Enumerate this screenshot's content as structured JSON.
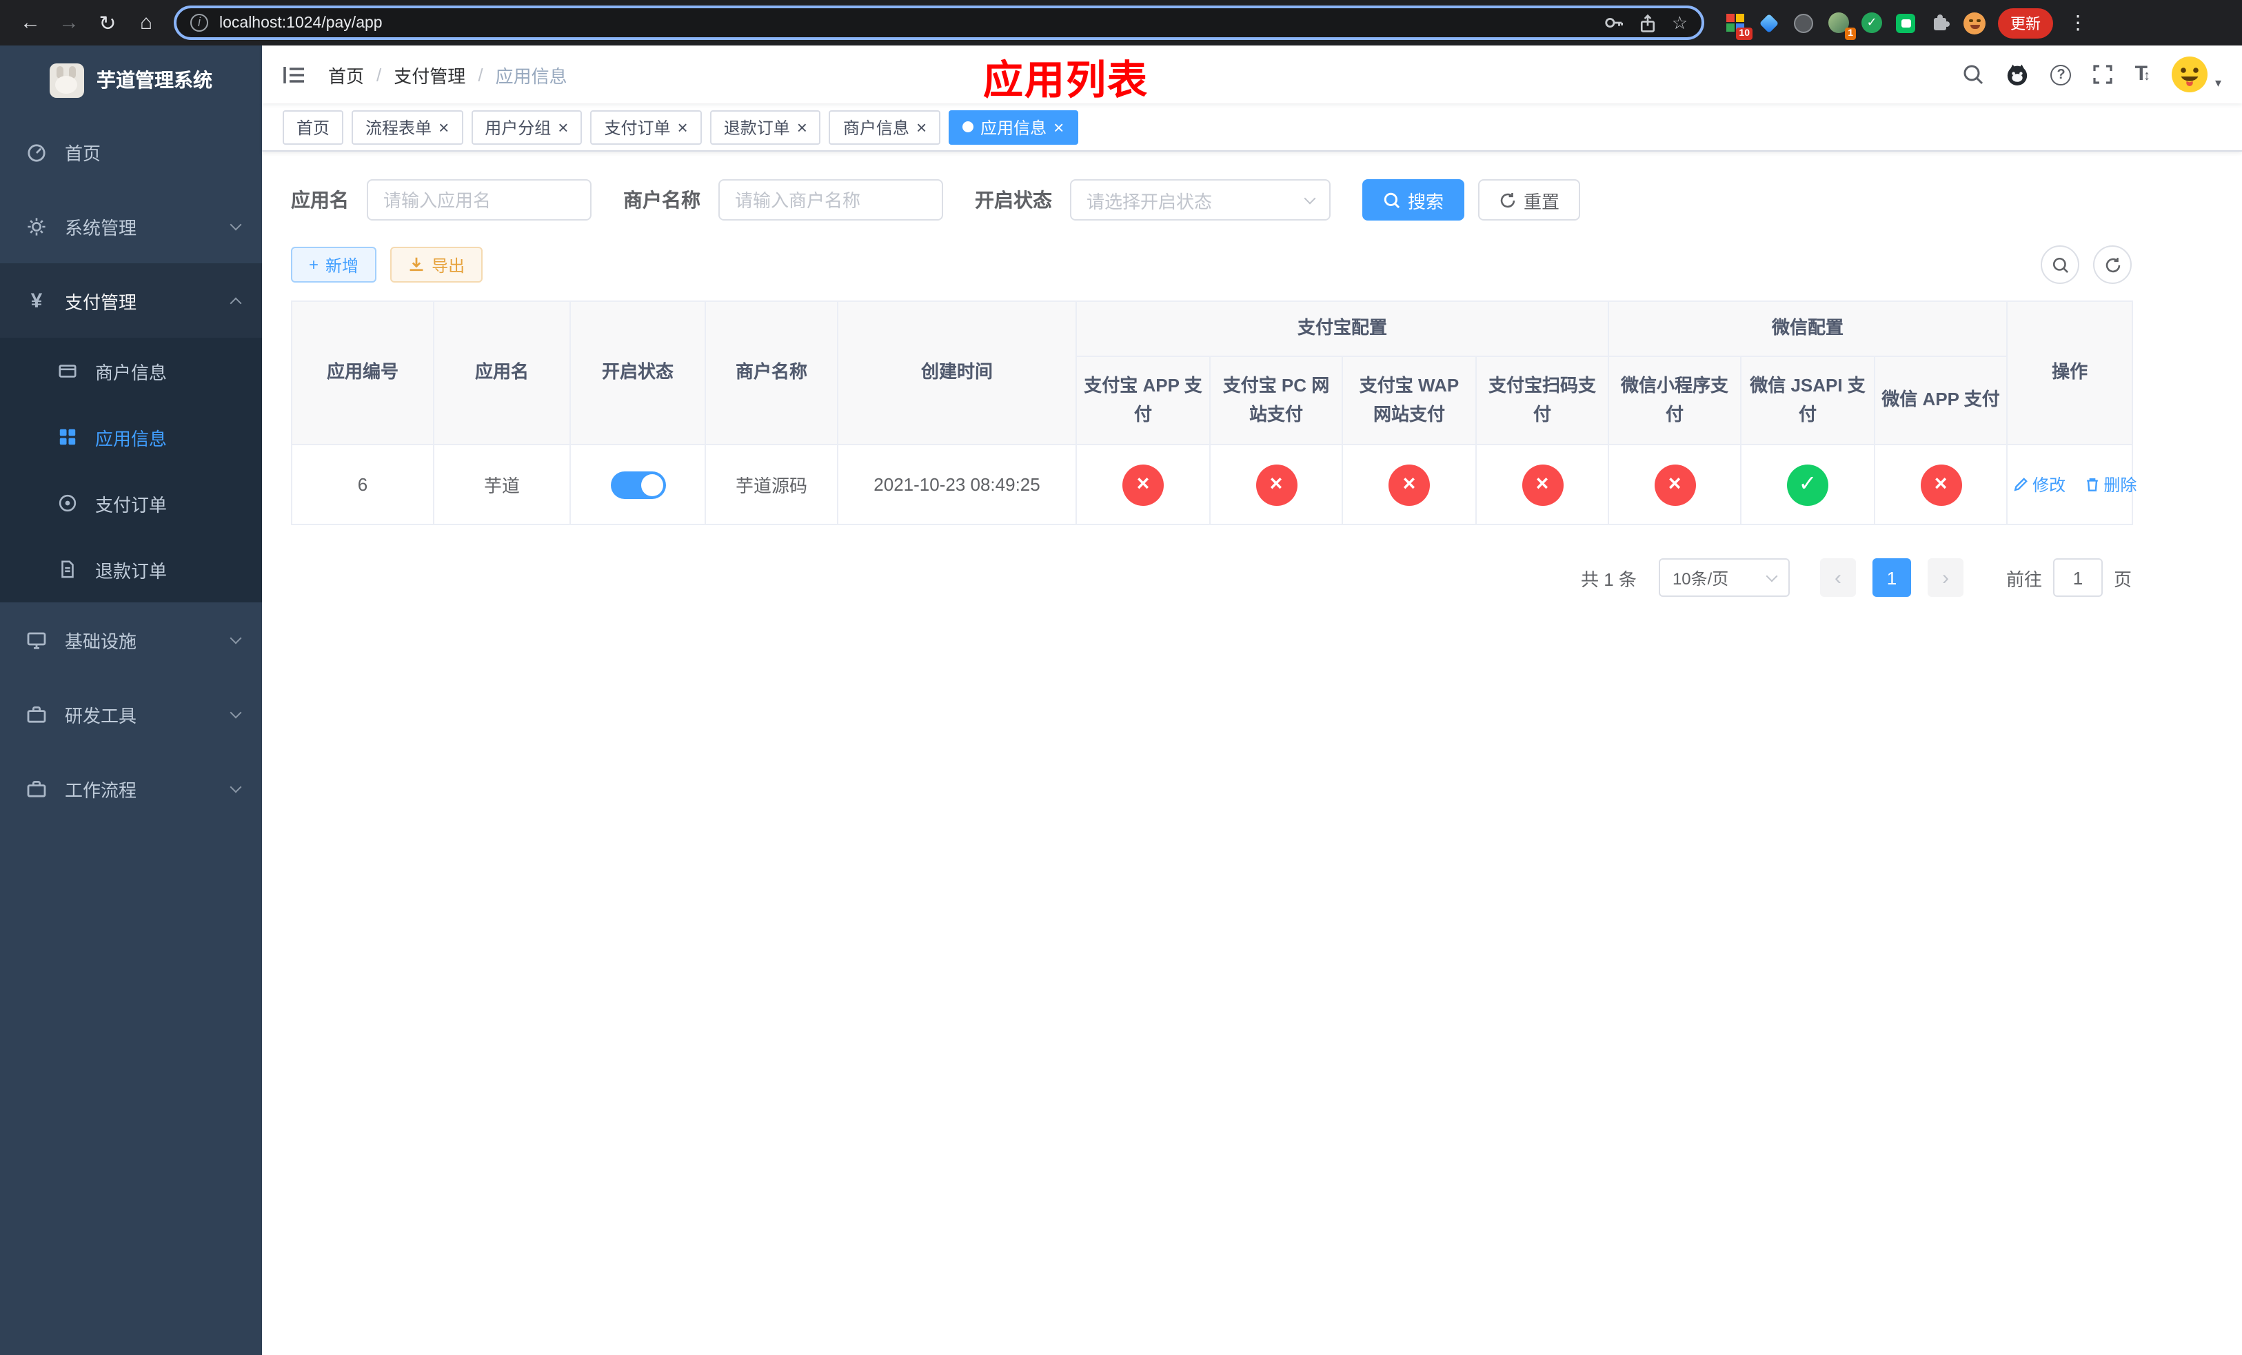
{
  "colors": {
    "accent": "#409eff",
    "danger": "#fa4b4b",
    "success": "#13ce66",
    "page_title": "#ff0000",
    "sidebar_bg": "#304156",
    "submenu_bg": "#1f2d3d"
  },
  "browser": {
    "url": "localhost:1024/pay/app",
    "update_label": "更新",
    "ext_badge_blocks": "10",
    "ext_badge_avatar": "1"
  },
  "sidebar": {
    "app_title": "芋道管理系统",
    "home": "首页",
    "system": "系统管理",
    "payment": "支付管理",
    "merchant_info": "商户信息",
    "app_info": "应用信息",
    "pay_order": "支付订单",
    "refund_order": "退款订单",
    "infrastructure": "基础设施",
    "dev_tools": "研发工具",
    "workflow": "工作流程"
  },
  "breadcrumb": {
    "items": [
      "首页",
      "支付管理",
      "应用信息"
    ]
  },
  "page_title": "应用列表",
  "tabs": [
    {
      "label": "首页"
    },
    {
      "label": "流程表单"
    },
    {
      "label": "用户分组"
    },
    {
      "label": "支付订单"
    },
    {
      "label": "退款订单"
    },
    {
      "label": "商户信息"
    },
    {
      "label": "应用信息"
    }
  ],
  "filters": {
    "app_name_label": "应用名",
    "app_name_placeholder": "请输入应用名",
    "merchant_label": "商户名称",
    "merchant_placeholder": "请输入商户名称",
    "status_label": "开启状态",
    "status_placeholder": "请选择开启状态",
    "search_label": "搜索",
    "reset_label": "重置"
  },
  "toolbar": {
    "add_label": "新增",
    "export_label": "导出"
  },
  "table": {
    "plain_columns": [
      "应用编号",
      "应用名",
      "开启状态",
      "商户名称",
      "创建时间"
    ],
    "alipay_group_label": "支付宝配置",
    "alipay_columns": [
      "支付宝 APP 支付",
      "支付宝 PC 网站支付",
      "支付宝 WAP 网站支付",
      "支付宝扫码支付"
    ],
    "wechat_group_label": "微信配置",
    "wechat_columns": [
      "微信小程序支付",
      "微信 JSAPI 支付",
      "微信 APP 支付"
    ],
    "ops_column": "操作",
    "row": {
      "id": "6",
      "name": "芋道",
      "enabled": true,
      "merchant": "芋道源码",
      "created": "2021-10-23 08:49:25",
      "statuses": [
        false,
        false,
        false,
        false,
        false,
        true,
        false
      ],
      "edit_label": "修改",
      "delete_label": "删除"
    }
  },
  "pagination": {
    "total": "共 1 条",
    "page_size": "10条/页",
    "page": "1",
    "goto_label": "前往",
    "goto_value": "1",
    "goto_suffix": "页"
  },
  "icons": {
    "check": "✓",
    "cross": "×",
    "close": "×"
  }
}
